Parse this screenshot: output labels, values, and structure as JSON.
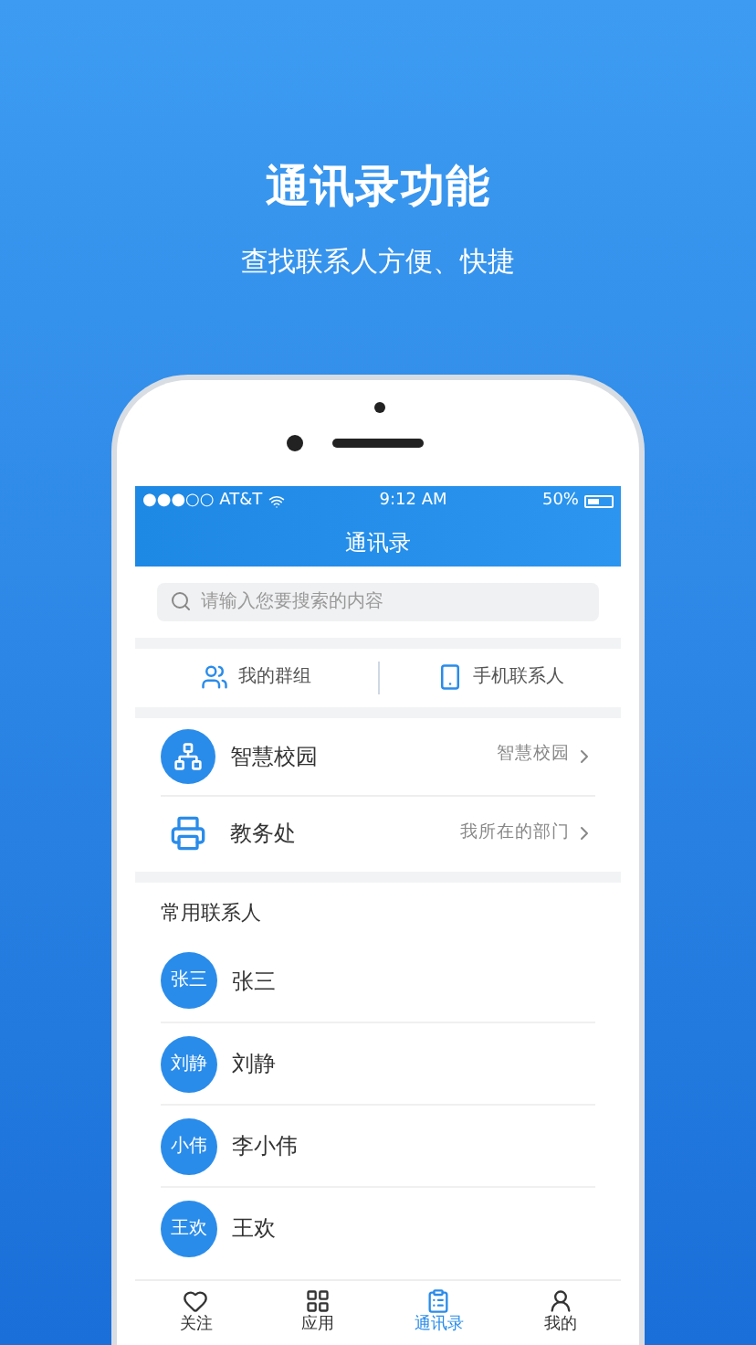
{
  "hero": {
    "title": "通讯录功能",
    "subtitle": "查找联系人方便、快捷"
  },
  "status_bar": {
    "carrier": "●●●○○ AT&T",
    "time": "9:12 AM",
    "battery": "50%"
  },
  "nav_title": "通讯录",
  "search": {
    "placeholder": "请输入您要搜索的内容"
  },
  "shortcuts": [
    {
      "kind": "group",
      "label": "我的群组"
    },
    {
      "kind": "phone",
      "label": "手机联系人"
    }
  ],
  "org_rows": [
    {
      "kind": "campus",
      "title": "智慧校园",
      "detail": "智慧校园"
    },
    {
      "kind": "office",
      "title": "教务处",
      "detail": "我所在的部门"
    }
  ],
  "contacts_title": "常用联系人",
  "contacts": [
    {
      "avatar": "张三",
      "name": "张三"
    },
    {
      "avatar": "刘静",
      "name": "刘静"
    },
    {
      "avatar": "小伟",
      "name": "李小伟"
    },
    {
      "avatar": "王欢",
      "name": "王欢"
    }
  ],
  "tab_bar": [
    {
      "kind": "follow",
      "label": "关注",
      "selected": false
    },
    {
      "kind": "apps",
      "label": "应用",
      "selected": false
    },
    {
      "kind": "contacts",
      "label": "通讯录",
      "selected": true
    },
    {
      "kind": "me",
      "label": "我的",
      "selected": false
    }
  ]
}
